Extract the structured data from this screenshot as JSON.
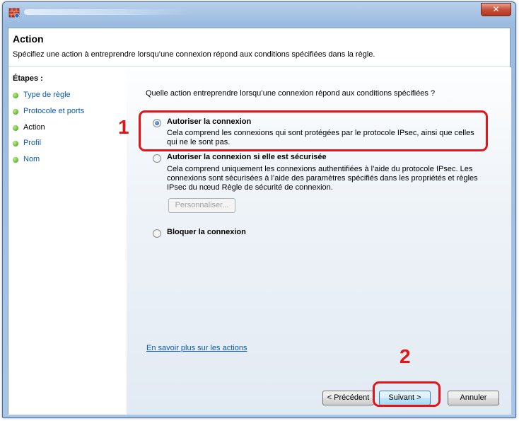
{
  "window": {
    "close_glyph": "✕"
  },
  "header": {
    "title": "Action",
    "description": "Spécifiez une action à entreprendre lorsqu’une connexion répond aux conditions spécifiées dans la règle."
  },
  "steps": {
    "label": "Étapes :",
    "items": [
      {
        "label": "Type de règle",
        "current": false
      },
      {
        "label": "Protocole et ports",
        "current": false
      },
      {
        "label": "Action",
        "current": true
      },
      {
        "label": "Profil",
        "current": false
      },
      {
        "label": "Nom",
        "current": false
      }
    ]
  },
  "main": {
    "question": "Quelle action entreprendre lorsqu’une connexion répond aux conditions spécifiées ?",
    "options": [
      {
        "title": "Autoriser la connexion",
        "description": "Cela comprend les connexions qui sont protégées par le protocole IPsec, ainsi que celles qui ne le sont pas.",
        "checked": true
      },
      {
        "title": "Autoriser la connexion si elle est sécurisée",
        "description": "Cela comprend uniquement les connexions authentifiées à l’aide du protocole IPsec. Les connexions sont sécurisées à l’aide des paramètres spécifiés dans les propriétés et règles IPsec du nœud Règle de sécurité de connexion.",
        "checked": false
      },
      {
        "title": "Bloquer la connexion",
        "checked": false
      }
    ],
    "customize_label": "Personnaliser...",
    "learn_more_link": "En savoir plus sur les actions"
  },
  "buttons": {
    "back": "< Précédent",
    "next": "Suivant >",
    "cancel": "Annuler"
  },
  "annotations": {
    "callout_1": "1",
    "callout_2": "2",
    "color": "#e3141a"
  }
}
